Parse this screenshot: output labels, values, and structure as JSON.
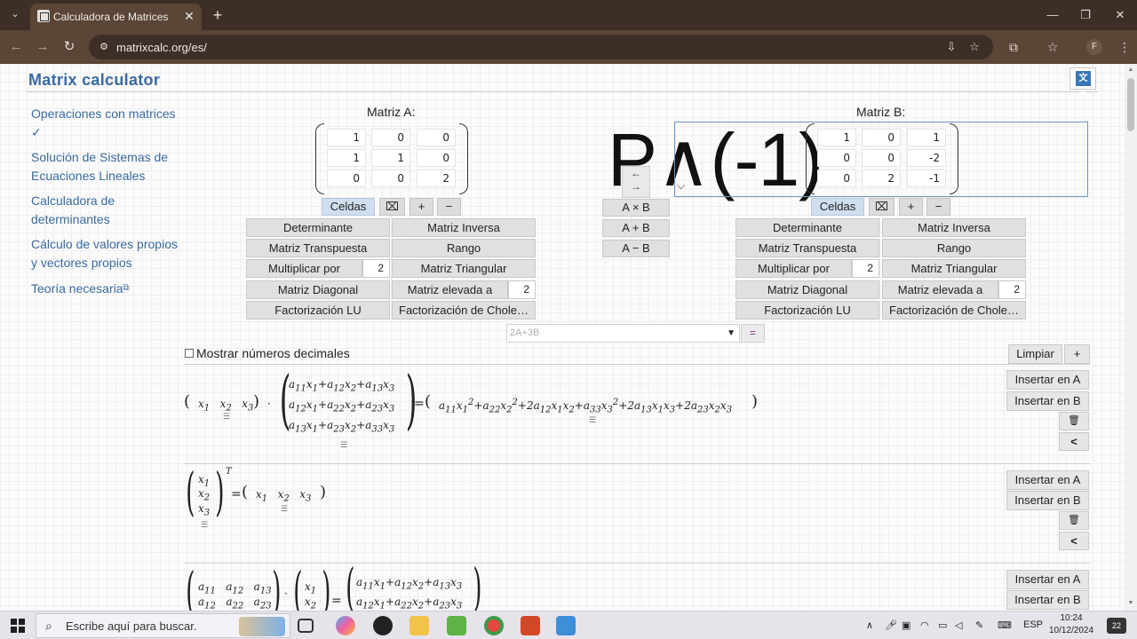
{
  "browser": {
    "tab_title": "Calculadora de Matrices",
    "tab_close": "✕",
    "new_tab": "+",
    "url": "matrixcalc.org/es/",
    "profile_initial": "F",
    "window": {
      "minimize": "—",
      "maximize": "❐",
      "close": "✕"
    }
  },
  "site": {
    "title": "Matrix calculator",
    "lang_icon": "文A"
  },
  "sidebar": {
    "items": [
      {
        "label": "Operaciones con matrices ✓"
      },
      {
        "label": "Solución de Sistemas de Ecuaciones Lineales"
      },
      {
        "label": "Calculadora de determinantes"
      },
      {
        "label": "Cálculo de valores propios y vectores propios"
      },
      {
        "label": "Teoría necesaria"
      }
    ],
    "external_icon": "⧉"
  },
  "matrixA": {
    "label": "Matriz A:",
    "cells": [
      [
        "1",
        "0",
        "0"
      ],
      [
        "1",
        "1",
        "0"
      ],
      [
        "0",
        "0",
        "2"
      ]
    ],
    "celdas": "Celdas",
    "plus": "+",
    "minus": "−",
    "ops": {
      "det": "Determinante",
      "inv": "Matriz Inversa",
      "trans": "Matriz Transpuesta",
      "rank": "Rango",
      "mult": "Multiplicar por",
      "mult_val": "2",
      "tri": "Matriz Triangular",
      "diag": "Matriz Diagonal",
      "pow": "Matriz elevada a",
      "pow_val": "2",
      "lu": "Factorización LU",
      "chol": "Factorización de Chole…"
    }
  },
  "matrixB": {
    "label": "Matriz B:",
    "cells": [
      [
        "1",
        "0",
        "1"
      ],
      [
        "0",
        "0",
        "-2"
      ],
      [
        "0",
        "2",
        "-1"
      ]
    ],
    "celdas": "Celdas",
    "plus": "+",
    "minus": "−",
    "ops": {
      "det": "Determinante",
      "inv": "Matriz Inversa",
      "trans": "Matriz Transpuesta",
      "rank": "Rango",
      "mult": "Multiplicar por",
      "mult_val": "2",
      "tri": "Matriz Triangular",
      "diag": "Matriz Diagonal",
      "pow": "Matriz elevada a",
      "pow_val": "2",
      "lu": "Factorización LU",
      "chol": "Factorización de Chole…"
    }
  },
  "overlay_text": "P∧(-1)",
  "swap": {
    "left": "←",
    "right": "→"
  },
  "binops": {
    "mul": "A × B",
    "add": "A + B",
    "sub": "A − B"
  },
  "expression": {
    "placeholder": "2A+3B",
    "equals": "="
  },
  "results": {
    "show_decimals": "Mostrar números decimales",
    "clear": "Limpiar",
    "add": "+",
    "insert_a": "Insertar en A",
    "insert_b": "Insertar en B",
    "delete_icon": "🗑",
    "share_icon": "<"
  },
  "taskbar": {
    "search_placeholder": "Escribe aquí para buscar.",
    "lang": "ESP",
    "time": "10:24",
    "date": "10/12/2024",
    "notifications": "22"
  }
}
